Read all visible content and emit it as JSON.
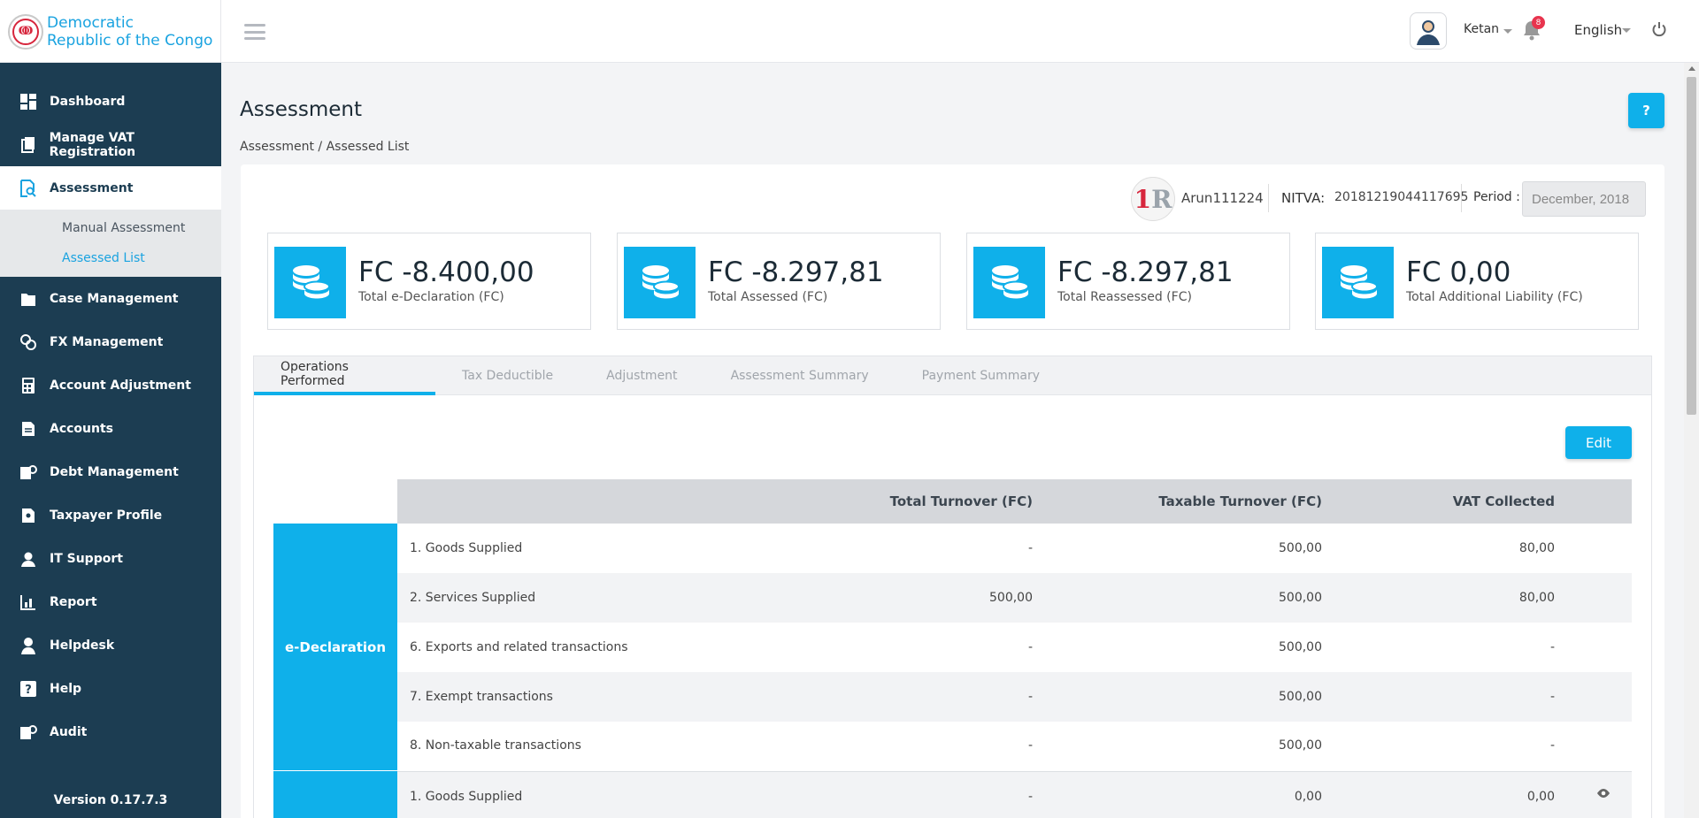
{
  "brand": {
    "line1": "Democratic",
    "line2": "Republic of the Congo"
  },
  "header": {
    "user": "Ketan",
    "notifications": "8",
    "language": "English"
  },
  "sidebar": {
    "items": [
      {
        "label": "Dashboard",
        "icon": "dashboard-icon"
      },
      {
        "label": "Manage VAT Registration",
        "icon": "document-icon"
      },
      {
        "label": "Assessment",
        "icon": "assessment-icon",
        "active": true
      },
      {
        "label": "Case Management",
        "icon": "folder-icon"
      },
      {
        "label": "FX Management",
        "icon": "exchange-icon"
      },
      {
        "label": "Account Adjustment",
        "icon": "calculator-icon"
      },
      {
        "label": "Accounts",
        "icon": "accounts-icon"
      },
      {
        "label": "Debt Management",
        "icon": "debt-icon"
      },
      {
        "label": "Taxpayer Profile",
        "icon": "profile-icon"
      },
      {
        "label": "IT Support",
        "icon": "support-icon"
      },
      {
        "label": "Report",
        "icon": "report-icon"
      },
      {
        "label": "Helpdesk",
        "icon": "helpdesk-icon"
      },
      {
        "label": "Help",
        "icon": "help-icon"
      },
      {
        "label": "Audit",
        "icon": "audit-icon"
      }
    ],
    "submenu": [
      "Manual Assessment",
      "Assessed List"
    ],
    "version": "Version 0.17.7.3"
  },
  "page": {
    "title": "Assessment",
    "help": "?",
    "breadcrumb": "Assessment / Assessed List"
  },
  "taxpayer": {
    "name": "Arun111224",
    "nitva_label": "NITVA:",
    "nitva": "20181219044117695",
    "period_label": "Period :",
    "period": "December, 2018"
  },
  "stats": [
    {
      "value": "FC -8.400,00",
      "label": "Total e-Declaration (FC)"
    },
    {
      "value": "FC -8.297,81",
      "label": "Total Assessed (FC)"
    },
    {
      "value": "FC -8.297,81",
      "label": "Total Reassessed (FC)"
    },
    {
      "value": "FC 0,00",
      "label": "Total Additional Liability (FC)"
    }
  ],
  "tabs": [
    "Operations Performed",
    "Tax Deductible",
    "Adjustment",
    "Assessment Summary",
    "Payment Summary"
  ],
  "edit_label": "Edit",
  "table": {
    "headers": [
      "Total Turnover (FC)",
      "Taxable Turnover (FC)",
      "VAT Collected"
    ],
    "group1": "e-Declaration",
    "rows": [
      [
        "1. Goods Supplied",
        "-",
        "500,00",
        "80,00"
      ],
      [
        "2. Services Supplied",
        "500,00",
        "500,00",
        "80,00"
      ],
      [
        "6. Exports and related transactions",
        "-",
        "500,00",
        "-"
      ],
      [
        "7. Exempt transactions",
        "-",
        "500,00",
        "-"
      ],
      [
        "8. Non-taxable transactions",
        "-",
        "500,00",
        "-"
      ],
      [
        "1. Goods Supplied",
        "-",
        "0,00",
        "0,00"
      ]
    ]
  },
  "colors": {
    "sidebar": "#1c3d52",
    "accent": "#0fb0ea",
    "brand": "#1aa3e0"
  }
}
